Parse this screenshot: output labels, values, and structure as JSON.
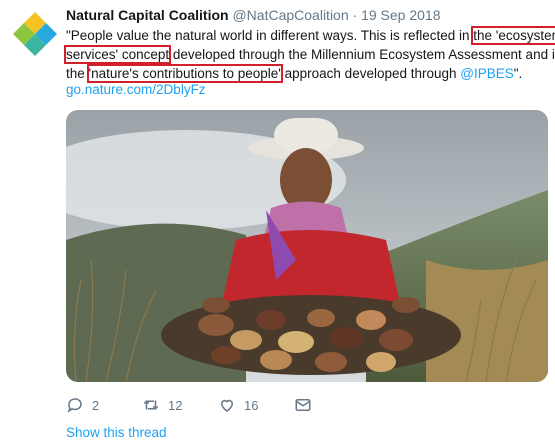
{
  "tweet": {
    "author_name": "Natural Capital Coalition",
    "author_handle": "@NatCapCoalition",
    "separator": "·",
    "date": "19 Sep 2018",
    "text": {
      "line1_a": "\"People value the natural world in different ways. This is reflected in ",
      "hl1": "the 'ecosystem",
      "hl1b": "services' concept",
      "line2_b": " developed through the Millennium Ecosystem Assessment and in",
      "line3_a": "the ",
      "hl2": "'nature's contributions to people'",
      "line3_b": " approach developed through ",
      "mention": "@IPBES",
      "line3_c": "\"."
    },
    "link": "go.nature.com/2DblyFz",
    "actions": {
      "replies": "2",
      "retweets": "12",
      "likes": "16"
    },
    "show_thread": "Show this thread"
  },
  "colors": {
    "accent": "#1da1f2",
    "highlight_box": "#d0202c",
    "muted": "#657786"
  },
  "icons": [
    "natural-capital-coalition-logo",
    "reply-icon",
    "retweet-icon",
    "like-icon",
    "message-icon"
  ]
}
